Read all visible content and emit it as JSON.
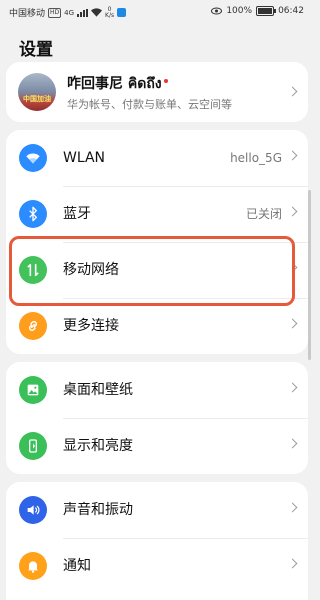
{
  "status_bar": {
    "carrier": "中国移动",
    "hd": "HD",
    "network": "4G",
    "speed_value": "0",
    "speed_unit": "K/s",
    "battery_pct": "100%",
    "battery_level": 1.0,
    "time": "06:42"
  },
  "page": {
    "title": "设置"
  },
  "account": {
    "avatar_text": "中国加油",
    "name": "咋回事尼 คิดถึง",
    "subtitle": "华为帐号、付款与账单、云空间等"
  },
  "groups": [
    {
      "items": [
        {
          "id": "wlan",
          "label": "WLAN",
          "value": "hello_5G",
          "icon": "wifi-icon",
          "color": "#2b8cff"
        },
        {
          "id": "bluetooth",
          "label": "蓝牙",
          "value": "已关闭",
          "icon": "bluetooth-icon",
          "color": "#2b8cff"
        },
        {
          "id": "mobile-network",
          "label": "移动网络",
          "value": "",
          "icon": "mobile-data-icon",
          "color": "#43c15b"
        },
        {
          "id": "more-connections",
          "label": "更多连接",
          "value": "",
          "icon": "link-icon",
          "color": "#ff9d1c"
        }
      ]
    },
    {
      "items": [
        {
          "id": "home-wallpaper",
          "label": "桌面和壁纸",
          "value": "",
          "icon": "wallpaper-icon",
          "color": "#3bbf58"
        },
        {
          "id": "display-brightness",
          "label": "显示和亮度",
          "value": "",
          "icon": "display-icon",
          "color": "#3bbf58"
        }
      ]
    },
    {
      "items": [
        {
          "id": "sound-vibration",
          "label": "声音和振动",
          "value": "",
          "icon": "sound-icon",
          "color": "#2f64e8"
        },
        {
          "id": "notifications",
          "label": "通知",
          "value": "",
          "icon": "bell-icon",
          "color": "#ffa21a"
        }
      ]
    }
  ],
  "colors": {
    "highlight": "#e55a3a",
    "background": "#f1f1f1"
  }
}
